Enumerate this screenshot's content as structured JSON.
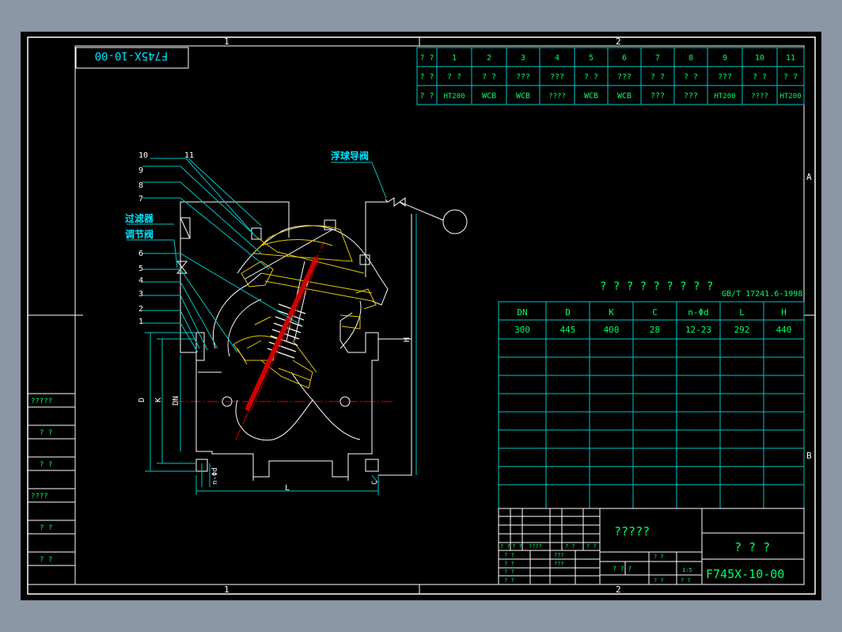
{
  "drawing_code_top": "F745X-10-00",
  "drawing_code_bottom": "F745X-10-00",
  "zone_labels": {
    "top_1": "1",
    "top_2": "2",
    "bottom_1": "1",
    "bottom_2": "2",
    "right_a": "A",
    "right_b": "B"
  },
  "parts_table": {
    "rows": [
      [
        "? ?",
        "1",
        "2",
        "3",
        "4",
        "5",
        "6",
        "7",
        "8",
        "9",
        "10",
        "11"
      ],
      [
        "? ?",
        "? ?",
        "? ?",
        "???",
        "???",
        "? ?",
        "???",
        "? ?",
        "? ?",
        "???",
        "? ?",
        "? ?"
      ],
      [
        "? ?",
        "HT200",
        "WCB",
        "WCB",
        "????",
        "WCB",
        "WCB",
        "???",
        "???",
        "HT200",
        "????",
        "HT200"
      ]
    ]
  },
  "dim_table": {
    "title": "? ? ? ? ? ? ? ? ?",
    "standard": "GB/T 17241.6-1998",
    "headers": [
      "DN",
      "D",
      "K",
      "C",
      "n-Φd",
      "L",
      "H"
    ],
    "values": [
      "300",
      "445",
      "400",
      "28",
      "12-23",
      "292",
      "440"
    ]
  },
  "callouts": {
    "float_valve": "浮球导阀",
    "filter": "过滤器",
    "regulator": "调节阀",
    "parts": [
      "10",
      "11",
      "9",
      "8",
      "7",
      "6",
      "5",
      "4",
      "3",
      "2",
      "1"
    ]
  },
  "dims": {
    "D": "D",
    "K": "K",
    "DN": "DN",
    "H": "H",
    "L": "L",
    "nd": "n-Φd",
    "C": "C"
  },
  "left_labels": [
    "?????",
    "? ?",
    "? ?",
    "????",
    "? ?",
    "? ?"
  ],
  "title_block": {
    "name": "?????",
    "org": "? ? ?",
    "code": "F745X-10-00",
    "scale": "1:5",
    "small": [
      "? ?",
      "? ?",
      "????",
      "? ?",
      "? ?",
      "? ?",
      "???",
      "? ?",
      "???",
      "? ?",
      "? ?",
      "? ? ?",
      "? ?",
      "? ?",
      "? ?"
    ]
  },
  "colors": {
    "frame": "#ffffff",
    "line": "#00c8c8",
    "text": "#00ff66",
    "title": "#00e5ff",
    "body": "#e6c800",
    "bg": "#000000"
  }
}
